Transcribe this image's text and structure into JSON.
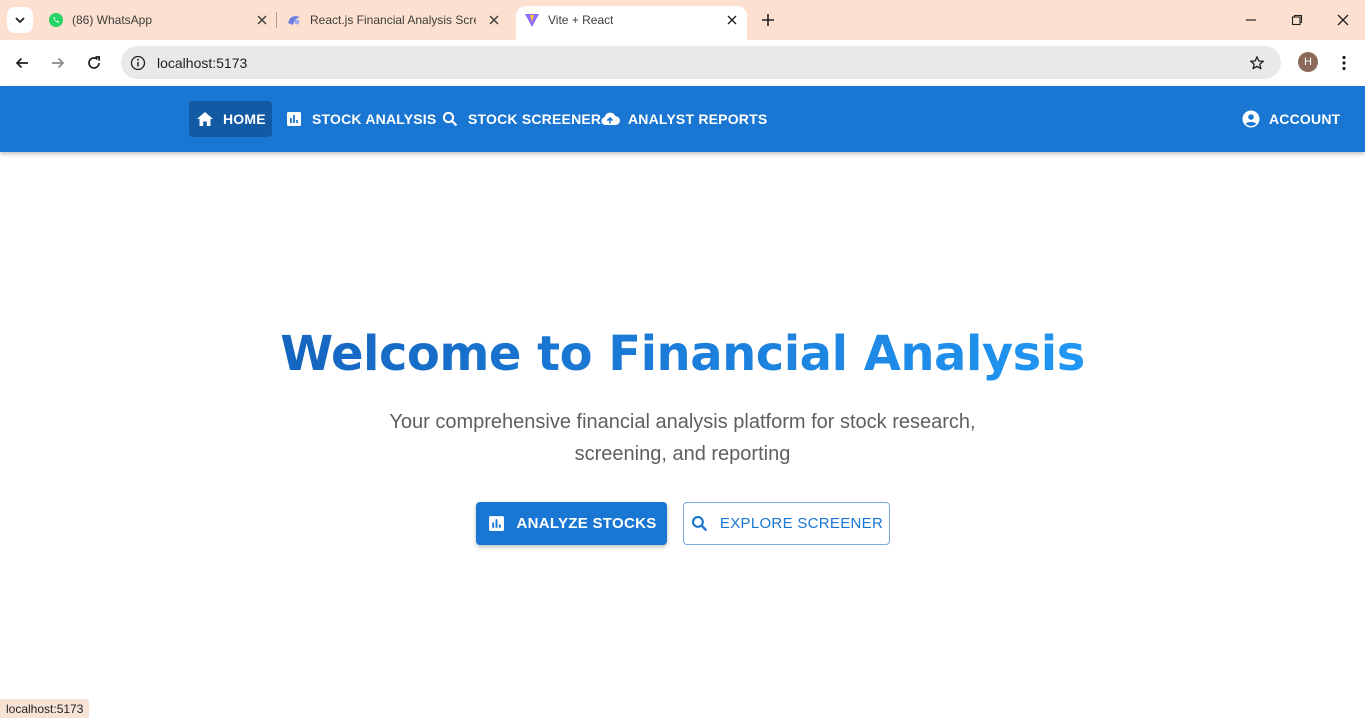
{
  "browser": {
    "tabs": [
      {
        "title": "(86) WhatsApp",
        "icon": "whatsapp-icon",
        "active": false
      },
      {
        "title": "React.js Financial Analysis Scree",
        "icon": "app-icon",
        "active": false
      },
      {
        "title": "Vite + React",
        "icon": "vite-icon",
        "active": true
      }
    ],
    "url": "localhost:5173",
    "profile_initial": "H",
    "status_text": "localhost:5173"
  },
  "nav": {
    "items": [
      {
        "label": "HOME",
        "icon": "home-icon",
        "active": true
      },
      {
        "label": "STOCK ANALYSIS",
        "icon": "bar-chart-icon",
        "active": false
      },
      {
        "label": "STOCK SCREENER",
        "icon": "search-icon",
        "active": false
      },
      {
        "label": "ANALYST REPORTS",
        "icon": "cloud-upload-icon",
        "active": false
      }
    ],
    "account_label": "ACCOUNT"
  },
  "hero": {
    "title": "Welcome to Financial Analysis",
    "subtitle": "Your comprehensive financial analysis platform for stock research, screening, and reporting",
    "primary_button": "ANALYZE STOCKS",
    "secondary_button": "EXPLORE SCREENER"
  },
  "colors": {
    "primary": "#1976d2",
    "tabstrip": "#fde0cf",
    "active_nav": "#125aa3"
  }
}
